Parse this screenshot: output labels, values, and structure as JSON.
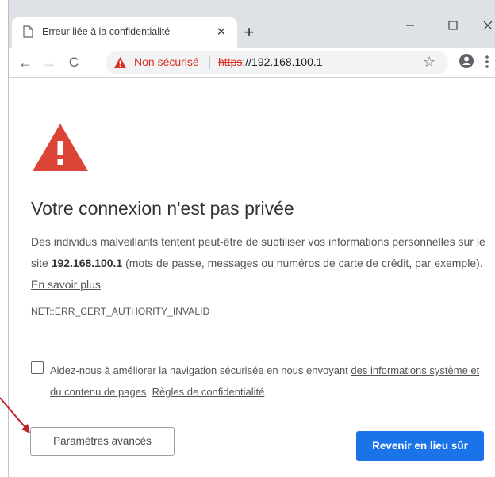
{
  "tab": {
    "title": "Erreur liée à la confidentialité",
    "close": "✕",
    "new_tab": "+"
  },
  "window": {
    "minimize": "–",
    "maximize": "☐",
    "close": "✕"
  },
  "toolbar": {
    "back": "←",
    "forward": "→",
    "reload": "C",
    "security_label": "Non sécurisé",
    "url_scheme": "https",
    "url_rest": "://192.168.100.1",
    "star": "☆"
  },
  "page": {
    "title": "Votre connexion n'est pas privée",
    "desc_part1": "Des individus malveillants tentent peut-être de subtiliser vos informations personnelles sur le site ",
    "desc_host": "192.168.100.1",
    "desc_part2": " (mots de passe, messages ou numéros de carte de crédit, par exemple). ",
    "learn_more": "En savoir plus",
    "error_code": "NET::ERR_CERT_AUTHORITY_INVALID",
    "checkbox_text": "Aidez-nous à améliorer la navigation sécurisée en nous envoyant ",
    "checkbox_link": "des informations système et du contenu de pages",
    "checkbox_sep": ". ",
    "privacy_link": "Règles de confidentialité",
    "advanced_button": "Paramètres avancés",
    "back_button": "Revenir en lieu sûr"
  },
  "colors": {
    "danger": "#d93025",
    "primary": "#1a73e8",
    "arrow": "#c0232b"
  }
}
